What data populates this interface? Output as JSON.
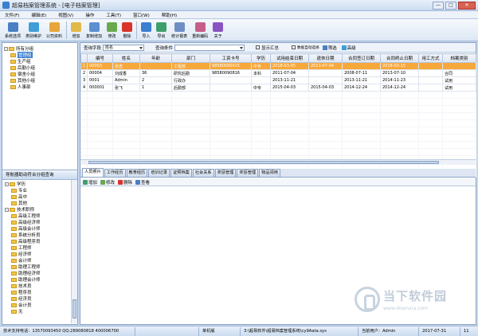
{
  "window": {
    "title": "超易档案管理系统 - [电子档案管理]",
    "min": "—",
    "max": "□",
    "close": "✕"
  },
  "menu": [
    "文件(F)",
    "编辑(E)",
    "视图(V)",
    "操作",
    "工具(T)",
    "窗口(W)",
    "帮助(H)"
  ],
  "toolbar": [
    {
      "label": "系统选项",
      "color": "#4a7fc4"
    },
    {
      "label": "类别维护",
      "color": "#3f9ed8"
    },
    {
      "label": "公司资料",
      "color": "#e7a63a"
    },
    {
      "label": "增加",
      "color": "#e3b84a"
    },
    {
      "label": "复制增加",
      "color": "#5b8fd0"
    },
    {
      "label": "修改",
      "color": "#6aa84f"
    },
    {
      "label": "删除",
      "color": "#d9342b"
    },
    {
      "label": "导入",
      "color": "#3b7fd0"
    },
    {
      "label": "导出",
      "color": "#3f9f6c"
    },
    {
      "label": "统计报表",
      "color": "#6d8fc6"
    },
    {
      "label": "重新编码",
      "color": "#c65e8a"
    },
    {
      "label": "关于",
      "color": "#8a55c2"
    }
  ],
  "tree": {
    "root": "所有分组",
    "items": [
      "管理组",
      "生产组",
      "后勤小组",
      "宿舍小组",
      "其他小组",
      "人事部"
    ],
    "selected": "管理组"
  },
  "nav": {
    "title": "导航器助动符合分组查询",
    "items": [
      {
        "label": "学历",
        "level": 0,
        "pm": "-"
      },
      {
        "label": "专业",
        "level": 1
      },
      {
        "label": "高中",
        "level": 1
      },
      {
        "label": "其他",
        "level": 1
      },
      {
        "label": "技术职称",
        "level": 0,
        "pm": "-"
      },
      {
        "label": "高级工程师",
        "level": 1
      },
      {
        "label": "高级经济师",
        "level": 1
      },
      {
        "label": "高级会计师",
        "level": 1
      },
      {
        "label": "系统分析员",
        "level": 1
      },
      {
        "label": "高级程序员",
        "level": 1
      },
      {
        "label": "工程师",
        "level": 1
      },
      {
        "label": "经济师",
        "level": 1
      },
      {
        "label": "会计师",
        "level": 1
      },
      {
        "label": "助理工程师",
        "level": 1
      },
      {
        "label": "助理经济师",
        "level": 1
      },
      {
        "label": "助理会计师",
        "level": 1
      },
      {
        "label": "技术员",
        "level": 1
      },
      {
        "label": "程序员",
        "level": 1
      },
      {
        "label": "经济员",
        "level": 1
      },
      {
        "label": "会计员",
        "level": 1
      },
      {
        "label": "无",
        "level": 1
      }
    ]
  },
  "filter": {
    "field_label": "查询字段",
    "field_value": "姓名",
    "cond_label": "查询条件",
    "cond_value": "",
    "show_summary": "显示汇总",
    "auto_choose": "数据自动选择",
    "filter_btn": "筛选",
    "advanced": "高级"
  },
  "grid": {
    "columns": [
      "",
      "编号",
      "姓名",
      "年龄",
      "部门",
      "工资卡号",
      "学历",
      "试用结束日期",
      "退休日期",
      "合同签订日期",
      "合同终止日期",
      "用工方式",
      "档案类别"
    ],
    "rows": [
      {
        "n": "1",
        "cells": [
          "00003",
          "张忠",
          "",
          "工程部",
          "98580090415",
          "中专",
          "2018-03-05",
          "2013-07-04",
          "",
          "2018-03-15",
          "",
          "",
          "技术干部"
        ],
        "hl": true
      },
      {
        "n": "2",
        "cells": [
          "00004",
          "刘成香",
          "36",
          "研究后勤",
          "98580090816",
          "本科",
          "2011-07-04",
          "",
          "2008-07-11",
          "2013-07-10",
          "",
          "合同",
          ""
        ]
      },
      {
        "n": "3",
        "cells": [
          "0001",
          "Admin",
          "2",
          "行政办",
          "",
          "",
          "2013-11-21",
          "",
          "2013-11-21",
          "2014-11-23",
          "",
          "试用",
          ""
        ]
      },
      {
        "n": "4",
        "cells": [
          "000001",
          "张飞",
          "1",
          "后勤部",
          "",
          "中专",
          "2015-04-03",
          "2015-04-03",
          "2014-12-24",
          "2014-12-24",
          "",
          "试用",
          "政府档案"
        ]
      }
    ]
  },
  "tabs": [
    "人员照片",
    "工作经历",
    "教育经历",
    "培训记录",
    "证照档案",
    "社会关系",
    "奖惩管理",
    "奖惩管理",
    "物品领用"
  ],
  "subtoolbar": [
    {
      "label": "增加",
      "color": "#3f9f6c"
    },
    {
      "label": "修改",
      "color": "#6aa84f"
    },
    {
      "label": "删除",
      "color": "#d9342b"
    },
    {
      "label": "查看",
      "color": "#4a7fc4"
    }
  ],
  "watermark": {
    "text": "当下软件园",
    "url": "www.downxia.com"
  },
  "status": [
    "技术支持电话：13570093450  QQ:289080818  400006700",
    "",
    "单机版",
    "3:\\超易软件\\超易档案管理系统\\cy9Aata.sys",
    "当前用户：Admin",
    "2017-07-31",
    "11"
  ]
}
